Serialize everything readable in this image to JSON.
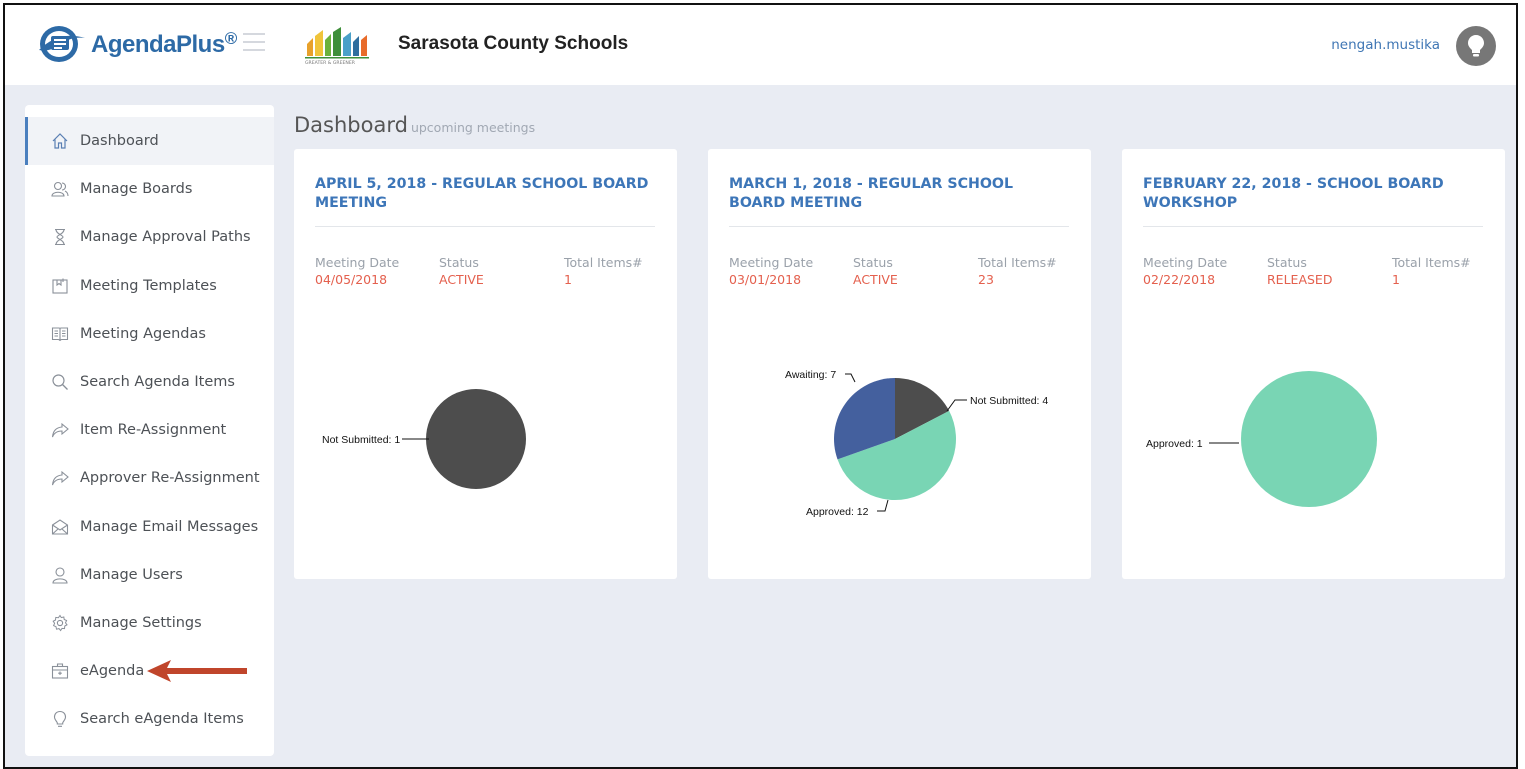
{
  "header": {
    "app_name": "AgendaPlus",
    "app_name_mark": "®",
    "org_name": "Sarasota County Schools",
    "org_logo_text": "GREATER & GREENER",
    "user": "nengah.mustika"
  },
  "sidebar": {
    "items": [
      {
        "label": "Dashboard",
        "icon": "home-icon",
        "active": true
      },
      {
        "label": "Manage Boards",
        "icon": "users-icon"
      },
      {
        "label": "Manage Approval Paths",
        "icon": "hourglass-icon"
      },
      {
        "label": "Meeting Templates",
        "icon": "template-icon"
      },
      {
        "label": "Meeting Agendas",
        "icon": "book-icon"
      },
      {
        "label": "Search Agenda Items",
        "icon": "search-icon"
      },
      {
        "label": "Item Re-Assignment",
        "icon": "share-arrow-icon"
      },
      {
        "label": "Approver Re-Assignment",
        "icon": "share-arrow-icon"
      },
      {
        "label": "Manage Email Messages",
        "icon": "envelope-icon"
      },
      {
        "label": "Manage Users",
        "icon": "user-icon"
      },
      {
        "label": "Manage Settings",
        "icon": "gear-icon"
      },
      {
        "label": "eAgenda",
        "icon": "briefcase-icon"
      },
      {
        "label": "Search eAgenda Items",
        "icon": "lightbulb-icon"
      }
    ]
  },
  "main": {
    "title": "Dashboard",
    "subtitle": "upcoming meetings",
    "labels": {
      "date": "Meeting Date",
      "status": "Status",
      "total": "Total Items#"
    }
  },
  "colors": {
    "accent": "#3d76b8",
    "value_red": "#e4604e",
    "not_submitted": "#4d4d4d",
    "awaiting": "#44609e",
    "approved": "#79d5b4",
    "arrow": "#c0452b"
  },
  "meetings": [
    {
      "title": "APRIL 5, 2018 - REGULAR SCHOOL BOARD MEETING",
      "date": "04/05/2018",
      "status": "ACTIVE",
      "total": "1",
      "chart_data": {
        "type": "pie",
        "slices": [
          {
            "label": "Not Submitted",
            "value": 1,
            "text": "Not Submitted: 1"
          }
        ]
      }
    },
    {
      "title": "MARCH 1, 2018 - REGULAR SCHOOL BOARD MEETING",
      "date": "03/01/2018",
      "status": "ACTIVE",
      "total": "23",
      "chart_data": {
        "type": "pie",
        "slices": [
          {
            "label": "Not Submitted",
            "value": 4,
            "text": "Not Submitted: 4"
          },
          {
            "label": "Approved",
            "value": 12,
            "text": "Approved: 12"
          },
          {
            "label": "Awaiting",
            "value": 7,
            "text": "Awaiting: 7"
          }
        ]
      }
    },
    {
      "title": "FEBRUARY 22, 2018 - SCHOOL BOARD WORKSHOP",
      "date": "02/22/2018",
      "status": "RELEASED",
      "total": "1",
      "chart_data": {
        "type": "pie",
        "slices": [
          {
            "label": "Approved",
            "value": 1,
            "text": "Approved: 1"
          }
        ]
      }
    }
  ]
}
